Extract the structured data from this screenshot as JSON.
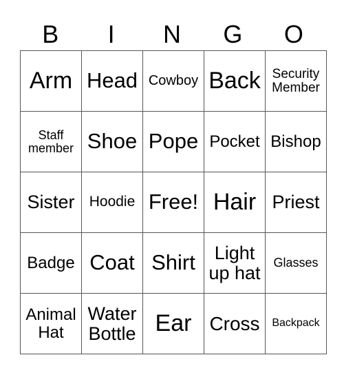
{
  "header": [
    "B",
    "I",
    "N",
    "G",
    "O"
  ],
  "cells": [
    [
      {
        "text": "Arm",
        "size": 34
      },
      {
        "text": "Head",
        "size": 31
      },
      {
        "text": "Cowboy",
        "size": 20
      },
      {
        "text": "Back",
        "size": 34
      },
      {
        "text": "Security Member",
        "size": 19
      }
    ],
    [
      {
        "text": "Staff member",
        "size": 18
      },
      {
        "text": "Shoe",
        "size": 31
      },
      {
        "text": "Pope",
        "size": 31
      },
      {
        "text": "Pocket",
        "size": 24
      },
      {
        "text": "Bishop",
        "size": 24
      }
    ],
    [
      {
        "text": "Sister",
        "size": 27
      },
      {
        "text": "Hoodie",
        "size": 21
      },
      {
        "text": "Free!",
        "size": 31
      },
      {
        "text": "Hair",
        "size": 34
      },
      {
        "text": "Priest",
        "size": 27
      }
    ],
    [
      {
        "text": "Badge",
        "size": 24
      },
      {
        "text": "Coat",
        "size": 31
      },
      {
        "text": "Shirt",
        "size": 31
      },
      {
        "text": "Light up hat",
        "size": 27
      },
      {
        "text": "Glasses",
        "size": 18
      }
    ],
    [
      {
        "text": "Animal Hat",
        "size": 24
      },
      {
        "text": "Water Bottle",
        "size": 27
      },
      {
        "text": "Ear",
        "size": 34
      },
      {
        "text": "Cross",
        "size": 28
      },
      {
        "text": "Backpack",
        "size": 16
      }
    ]
  ]
}
